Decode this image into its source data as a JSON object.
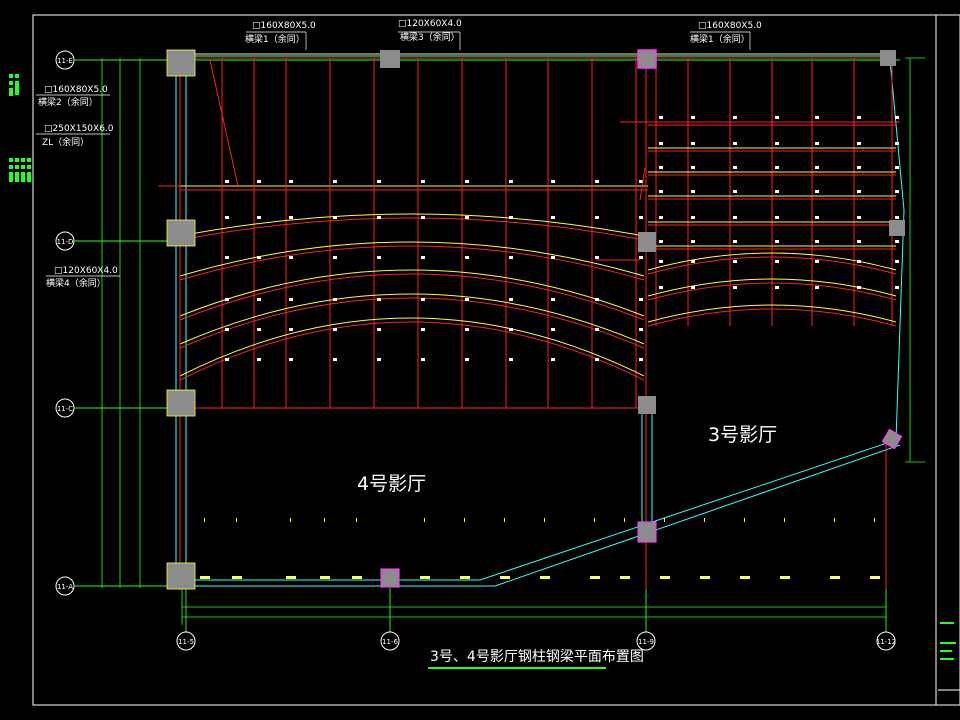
{
  "labels": {
    "beam1_spec": "□160X80X5.0",
    "beam1_name": "横梁1（余同）",
    "beam3_spec": "□120X60X4.0",
    "beam3_name": "横梁3（余同）",
    "beam1b_spec": "□160X80X5.0",
    "beam1b_name": "横梁1（余同）",
    "beam2_spec": "□160X80X5.0",
    "beam2_name": "横梁2（余同）",
    "zl_spec": "□250X150X6.0",
    "zl_name": "ZL（余同）",
    "beam4_spec": "□120X60X4.0",
    "beam4_name": "横梁4（余同）"
  },
  "hall3": "3号影厅",
  "hall4": "4号影厅",
  "drawing_title": "3号、4号影厅钢柱钢梁平面布置图",
  "axes": {
    "rows": [
      "11-E",
      "11-D",
      "11-C",
      "11-A"
    ],
    "cols": [
      "11-5",
      "11-6",
      "11-9",
      "11-12"
    ]
  },
  "colors": {
    "background": "#000000",
    "beam_red": "#ff2020",
    "beam_yellow": "#ffff33",
    "axis_green": "#22ff22",
    "column_grey": "#8c8c8c",
    "cyan": "#33ffff",
    "magenta": "#ff33ff",
    "white": "#ffffff"
  }
}
